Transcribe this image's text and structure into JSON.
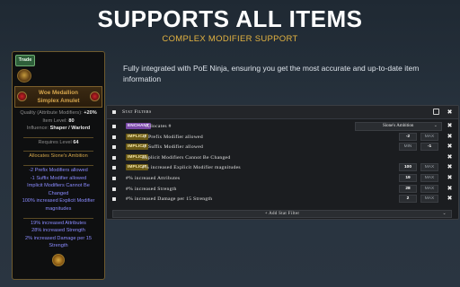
{
  "headline": "SUPPORTS ALL ITEMS",
  "subheadline": "COMPLEX MODIFIER SUPPORT",
  "description": "Fully integrated with PoE Ninja, ensuring you get the most accurate and up-to-date item information",
  "item": {
    "trade_badge": "Trade",
    "name": "Woe Medallion",
    "base": "Simplex Amulet",
    "quality_label": "Quality (Attribute Modifiers): ",
    "quality_value": "+20%",
    "item_level_label": "Item Level: ",
    "item_level_value": "80",
    "influence_label": "Influence: ",
    "influence_value": "Shaper / Warlord",
    "requires_label": "Requires Level ",
    "requires_value": "64",
    "enchant": "Allocates Sione's Ambition",
    "implicits": [
      "-2 Prefix Modifiers allowed",
      "-1 Suffix Modifier allowed",
      "Implicit Modifiers Cannot Be Changed",
      "100% increased Explicit Modifier magnitudes"
    ],
    "explicits": [
      "19% increased Attributes",
      "28% increased Strength",
      "2% increased Damage per 15 Strength"
    ]
  },
  "filters": {
    "title": "Stat Filters",
    "add_label": "+ Add Stat Filter",
    "min_placeholder": "MIN",
    "max_placeholder": "MAX",
    "rows": [
      {
        "badge": "ENCHANT",
        "label": "Allocates #",
        "select": "Sione's Ambition"
      },
      {
        "badge": "IMPLICIT",
        "label": "-# Prefix Modifier allowed",
        "min": "-2",
        "max": "MAX"
      },
      {
        "badge": "IMPLICIT",
        "label": "-# Suffix Modifier allowed",
        "min": "MIN",
        "max": "-1"
      },
      {
        "badge": "IMPLICIT",
        "label": "Implicit Modifiers Cannot Be Changed"
      },
      {
        "badge": "IMPLICIT",
        "label": "#% increased Explicit Modifier magnitudes",
        "min": "100",
        "max": "MAX"
      },
      {
        "badge": "",
        "label": "#% increased Attributes",
        "min": "19",
        "max": "MAX"
      },
      {
        "badge": "",
        "label": "#% increased Strength",
        "min": "28",
        "max": "MAX"
      },
      {
        "badge": "",
        "label": "#% increased Damage per 15 Strength",
        "min": "2",
        "max": "MAX"
      }
    ]
  },
  "colors": {
    "headline": "#ffffff",
    "subheadline": "#e3b341",
    "enchant_badge": "#7b4aa8",
    "implicit_badge": "#6b5a16",
    "unique_name": "#d6a64d",
    "magic_mod": "#8a8bff"
  },
  "icons": {
    "edit": "edit-icon",
    "close": "close-icon",
    "checkbox": "checkbox-icon",
    "dropdown": "chevron-down-icon"
  }
}
